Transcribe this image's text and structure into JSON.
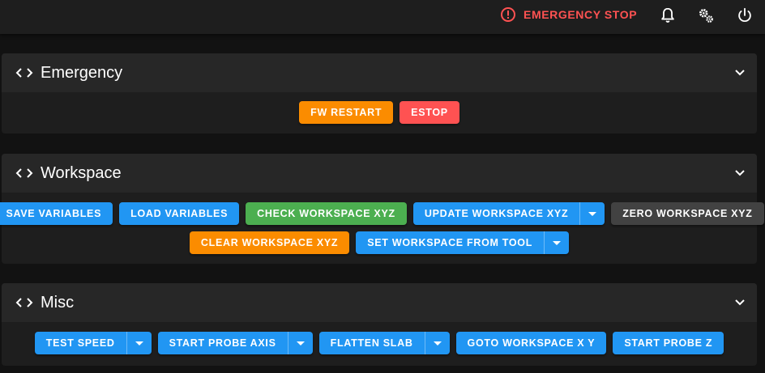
{
  "topbar": {
    "emergency_stop_label": "EMERGENCY STOP",
    "icons": [
      "alert-circle-icon",
      "bell-icon",
      "cogs-icon",
      "power-icon"
    ]
  },
  "panels": {
    "emergency": {
      "title": "Emergency",
      "buttons": {
        "fw_restart": "FW RESTART",
        "estop": "ESTOP"
      }
    },
    "workspace": {
      "title": "Workspace",
      "buttons": {
        "save_variables": "SAVE VARIABLES",
        "load_variables": "LOAD VARIABLES",
        "check_workspace": "CHECK WORKSPACE XYZ",
        "update_workspace": "UPDATE WORKSPACE XYZ",
        "zero_workspace": "ZERO WORKSPACE XYZ",
        "clear_workspace": "CLEAR WORKSPACE XYZ",
        "set_workspace_from_tool": "SET WORKSPACE FROM TOOL"
      }
    },
    "misc": {
      "title": "Misc",
      "buttons": {
        "test_speed": "TEST SPEED",
        "start_probe_axis": "START PROBE AXIS",
        "flatten_slab": "FLATTEN SLAB",
        "goto_workspace": "GOTO WORKSPACE X Y",
        "start_probe_z": "START PROBE Z"
      }
    }
  },
  "colors": {
    "primary": "#2196f3",
    "success": "#4caf50",
    "warning": "#fb8c00",
    "error": "#ff5252",
    "secondary": "#424242"
  }
}
